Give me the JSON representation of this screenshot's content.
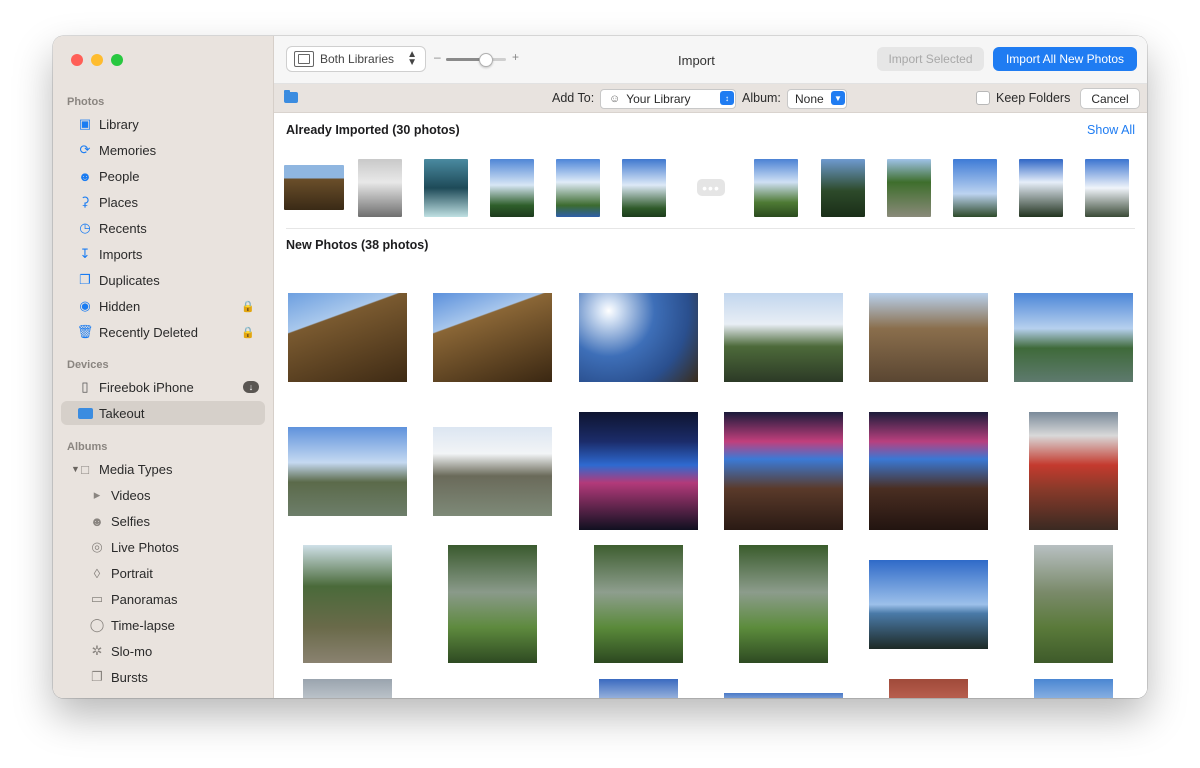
{
  "sidebar": {
    "photos_label": "Photos",
    "photos_items": [
      "Library",
      "Memories",
      "People",
      "Places",
      "Recents",
      "Imports",
      "Duplicates",
      "Hidden",
      "Recently Deleted"
    ],
    "devices_label": "Devices",
    "devices_items": [
      "Fireebok iPhone",
      "Takeout"
    ],
    "albums_label": "Albums",
    "media_types": "Media Types",
    "media_items": [
      "Videos",
      "Selfies",
      "Live Photos",
      "Portrait",
      "Panoramas",
      "Time-lapse",
      "Slo-mo",
      "Bursts"
    ]
  },
  "toolbar": {
    "library_select": "Both Libraries",
    "title": "Import",
    "import_selected": "Import Selected",
    "import_all": "Import All New Photos",
    "zoom_level": 0.65
  },
  "importbar": {
    "add_to_label": "Add To:",
    "add_to_value": "Your Library",
    "album_label": "Album:",
    "album_value": "None",
    "keep_folders": "Keep Folders",
    "cancel": "Cancel"
  },
  "content": {
    "already_imported": "Already Imported (30 photos)",
    "show_all": "Show All",
    "new_photos": "New Photos (38 photos)"
  },
  "colors": {
    "accent": "#1f7cf2",
    "sidebar_bg": "#e9e3de"
  }
}
